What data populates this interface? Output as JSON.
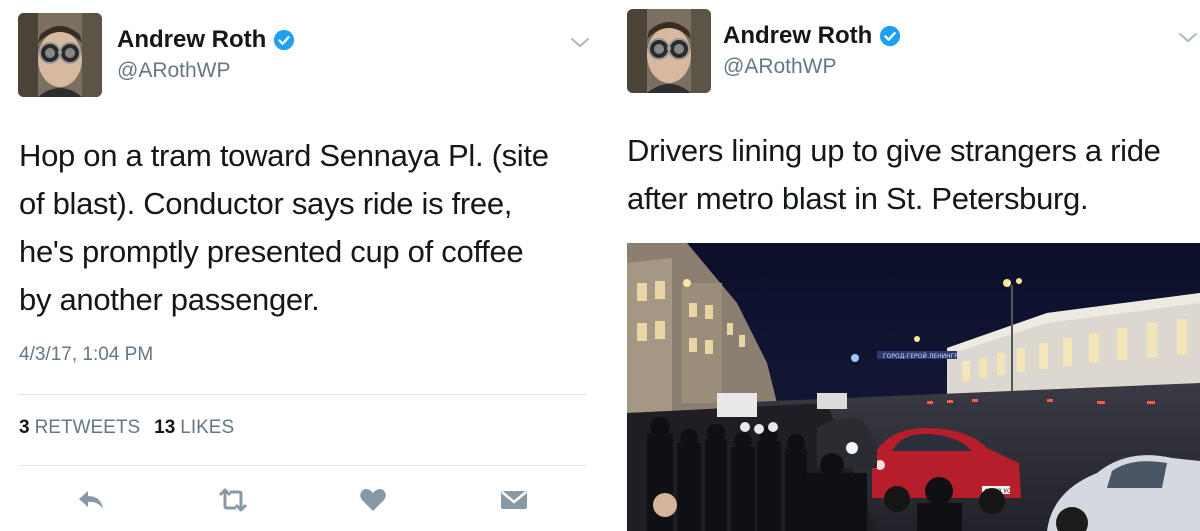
{
  "tweets": [
    {
      "author": {
        "name": "Andrew Roth",
        "handle": "@ARothWP"
      },
      "text": "Hop on a tram toward Sennaya Pl. (site of blast). Conductor says ride is free, he's promptly presented cup of coffee by another passenger.",
      "lines": [
        "Hop on a tram toward Sennaya Pl. (site",
        "of blast). Conductor says ride is free,",
        "he's promptly presented cup of coffee",
        "by another passenger."
      ],
      "timestamp": "4/3/17, 1:04 PM",
      "stats": {
        "retweets_count": "3",
        "retweets_label": "RETWEETS",
        "likes_count": "13",
        "likes_label": "LIKES"
      },
      "actions": [
        "reply-icon",
        "retweet-icon",
        "like-icon",
        "direct-message-icon"
      ]
    },
    {
      "author": {
        "name": "Andrew Roth",
        "handle": "@ARothWP"
      },
      "lines": [
        "Drivers lining up to give strangers a ride",
        "after metro blast in St. Petersburg."
      ],
      "photo": {
        "sign_text": "ГОРОД-ГЕРОЙ ЛЕНИНГРАД",
        "plate_text": "А 750 УС"
      }
    }
  ],
  "colors": {
    "verified": "#1da1f2",
    "secondary_text": "#657786",
    "action_icon": "#8899a6",
    "divider": "#e1e8ed"
  }
}
